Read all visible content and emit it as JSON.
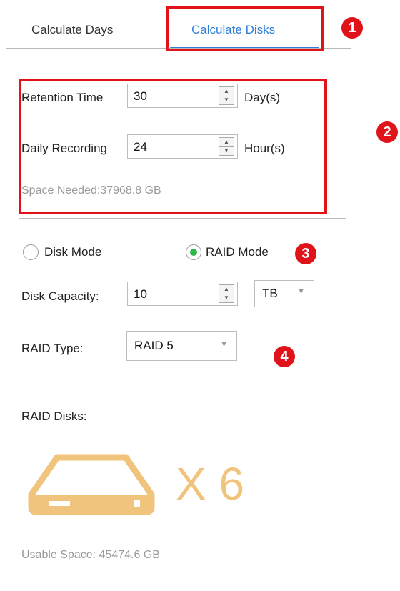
{
  "tabs": [
    {
      "label": "Calculate Days"
    },
    {
      "label": "Calculate Disks"
    }
  ],
  "retention": {
    "label": "Retention Time",
    "value": "30",
    "unit": "Day(s)"
  },
  "daily_recording": {
    "label": "Daily Recording",
    "value": "24",
    "unit": "Hour(s)"
  },
  "space_needed": "Space Needed:37968.8 GB",
  "modes": {
    "disk": "Disk Mode",
    "raid": "RAID Mode",
    "selected": "raid"
  },
  "disk_capacity": {
    "label": "Disk Capacity:",
    "value": "10",
    "unit": "TB"
  },
  "raid_type": {
    "label": "RAID Type:",
    "value": "RAID 5"
  },
  "raid_disks": {
    "label": "RAID Disks:",
    "multiplier": "X 6"
  },
  "usable_space": "Usable Space: 45474.6 GB",
  "annotations": [
    "1",
    "2",
    "3",
    "4"
  ],
  "colors": {
    "accent": "#2f7fd7",
    "annotation": "#e0131a",
    "radio_selected": "#2fb84a",
    "disk_icon": "#f1c47e"
  }
}
